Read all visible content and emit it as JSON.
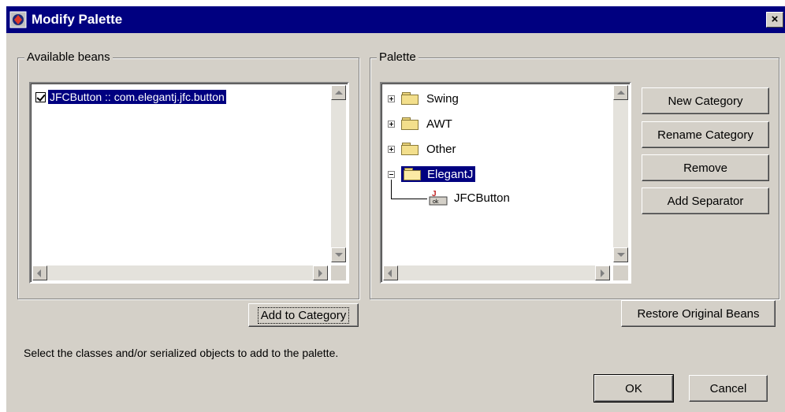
{
  "window": {
    "title": "Modify Palette",
    "close_label": "×"
  },
  "available_beans": {
    "group_label": "Available beans",
    "items": [
      {
        "label": "JFCButton :: com.elegantj.jfc.button",
        "checked": true
      }
    ],
    "add_button": "Add to Category"
  },
  "palette": {
    "group_label": "Palette",
    "tree": [
      {
        "label": "Swing",
        "state": "collapsed"
      },
      {
        "label": "AWT",
        "state": "collapsed"
      },
      {
        "label": "Other",
        "state": "collapsed"
      },
      {
        "label": "ElegantJ",
        "state": "expanded",
        "selected": true
      },
      {
        "label": "JFCButton",
        "child": true
      }
    ],
    "buttons": {
      "new_category": "New Category",
      "rename_category": "Rename Category",
      "remove": "Remove",
      "add_separator": "Add Separator"
    },
    "restore_button": "Restore Original Beans"
  },
  "status_text": "Select the classes and/or serialized objects to add to the palette.",
  "dialog_buttons": {
    "ok": "OK",
    "cancel": "Cancel"
  }
}
